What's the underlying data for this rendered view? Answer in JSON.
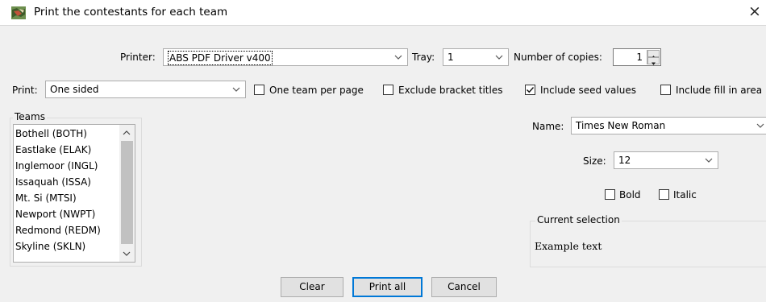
{
  "window": {
    "title": "Print the contestants for each team",
    "icon": "app-icon",
    "close_glyph": "×"
  },
  "printer": {
    "label": "Printer:",
    "value": "ABS PDF Driver v400"
  },
  "tray": {
    "label": "Tray:",
    "value": "1"
  },
  "copies": {
    "label": "Number of copies:",
    "value": "1"
  },
  "print_mode": {
    "label": "Print:",
    "value": "One sided"
  },
  "options": {
    "one_team_per_page": {
      "label": "One team per page",
      "checked": false
    },
    "exclude_bracket_titles": {
      "label": "Exclude bracket titles",
      "checked": false
    },
    "include_seed_values": {
      "label": "Include seed values",
      "checked": true
    },
    "include_fill_in_areas": {
      "label": "Include fill in area",
      "checked": false
    }
  },
  "teams": {
    "title": "Teams",
    "items": [
      "Bothell (BOTH)",
      "Eastlake (ELAK)",
      "Inglemoor (INGL)",
      "Issaquah (ISSA)",
      "Mt. Si (MTSI)",
      "Newport (NWPT)",
      "Redmond (REDM)",
      "Skyline (SKLN)"
    ]
  },
  "font": {
    "name_label": "Name:",
    "name_value": "Times New Roman",
    "size_label": "Size:",
    "size_value": "12",
    "bold_label": "Bold",
    "bold_checked": false,
    "italic_label": "Italic",
    "italic_checked": false
  },
  "current_selection": {
    "title": "Current selection",
    "sample": "Example text"
  },
  "buttons": {
    "clear": "Clear",
    "print_all": "Print all",
    "cancel": "Cancel"
  },
  "colors": {
    "accent": "#0078d7",
    "window_bg": "#f0f0f0",
    "field_bg": "#ffffff"
  }
}
